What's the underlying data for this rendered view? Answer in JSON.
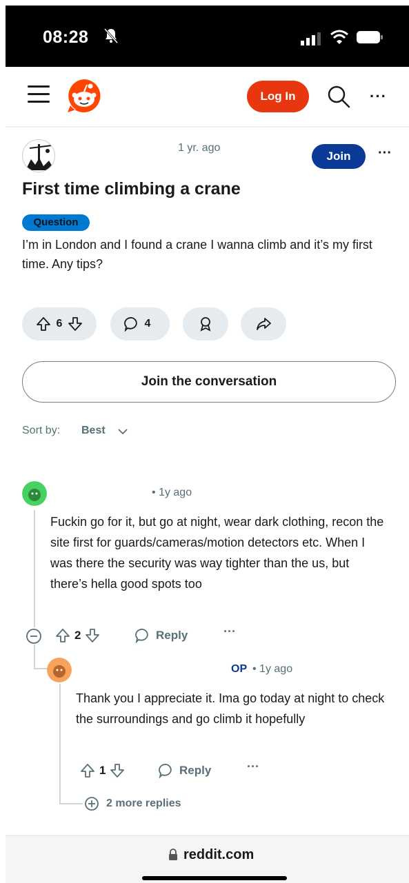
{
  "status_bar": {
    "time": "08:28"
  },
  "header": {
    "login_label": "Log In"
  },
  "post": {
    "time": "1 yr. ago",
    "join_label": "Join",
    "title": "First time climbing a crane",
    "flair": "Question",
    "body": "I’m in London and I found a crane I wanna climb and it’s my first time. Any tips?",
    "votes": "6",
    "comments": "4",
    "join_conversation_label": "Join the conversation"
  },
  "sort": {
    "label": "Sort by:",
    "value": "Best"
  },
  "comments": [
    {
      "meta": "• 1y ago",
      "text": "Fuckin go for it, but go at night, wear dark clothing, recon the site first for guards/cameras/motion detectors etc. When I was there the security was way tighter than the us, but there’s hella good spots too",
      "votes": "2",
      "reply_label": "Reply"
    },
    {
      "op_tag": "OP",
      "meta": "• 1y ago",
      "text": "Thank you I appreciate it. Ima go today at night to check the surroundings and go climb it hopefully",
      "votes": "1",
      "reply_label": "Reply",
      "more_replies": "2 more replies"
    }
  ],
  "footer": {
    "url": "reddit.com"
  },
  "colors": {
    "brand": "#e8360e",
    "join": "#0b3a96",
    "flair": "#0079d3",
    "pill": "#e5ebee"
  }
}
